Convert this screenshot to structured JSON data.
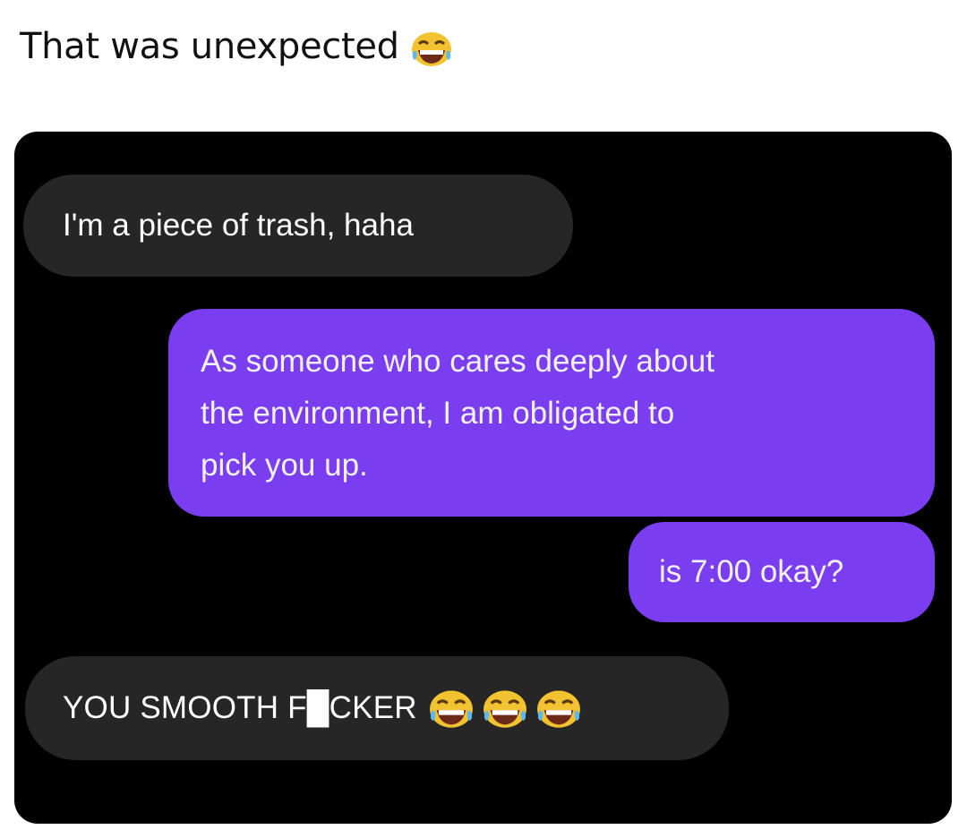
{
  "post": {
    "caption": "That was unexpected",
    "caption_emoji": "face-with-tears-of-joy-icon"
  },
  "conversation": {
    "messages": [
      {
        "direction": "incoming",
        "text": "I'm a piece of trash, haha"
      },
      {
        "direction": "outgoing",
        "lines": [
          "As someone who cares deeply about",
          "the environment, I am obligated to",
          "pick you up."
        ]
      },
      {
        "direction": "outgoing",
        "text": "is 7:00 okay?"
      },
      {
        "direction": "incoming",
        "text": "YOU SMOOTH F█CKER",
        "emoji_count": 3,
        "emoji": "face-with-tears-of-joy-icon"
      }
    ]
  },
  "colors": {
    "chat_background": "#000000",
    "incoming_bubble": "#262626",
    "outgoing_bubble": "#7a3df0",
    "bubble_text": "#ffffff",
    "caption_text": "#111111"
  }
}
